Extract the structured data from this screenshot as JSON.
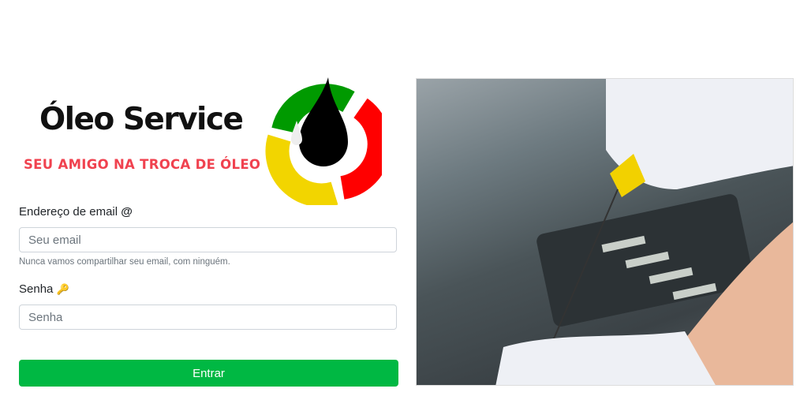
{
  "logo": {
    "brand": "Óleo Service",
    "slogan": "SEU AMIGO NA TROCA DE ÓLEO",
    "colors": {
      "green": "#009a00",
      "red": "#ff0000",
      "yellow": "#f2d500",
      "drop": "#000000"
    }
  },
  "form": {
    "email_label": "Endereço de email",
    "email_icon": "@",
    "email_placeholder": "Seu email",
    "email_help": "Nunca vamos compartilhar seu email, com ninguém.",
    "password_label": "Senha",
    "password_icon": "key-icon",
    "password_placeholder": "Senha",
    "submit_label": "Entrar",
    "submit_color": "#00b843"
  },
  "hero_image": {
    "subject": "gloved hand checking engine oil dipstick"
  }
}
